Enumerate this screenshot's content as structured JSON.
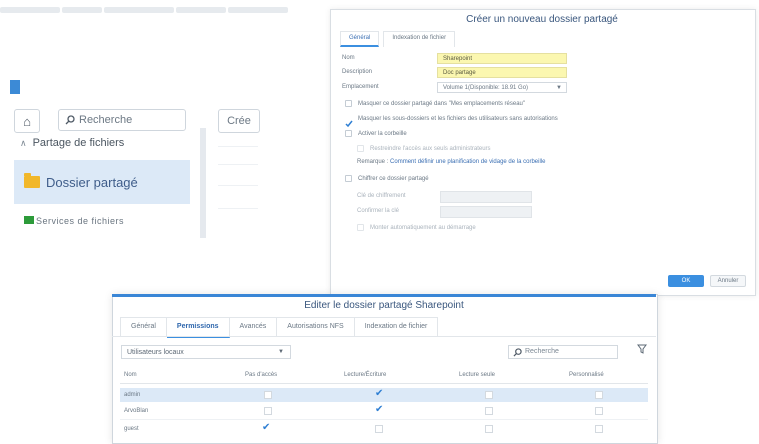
{
  "background": {
    "search_placeholder": "Recherche",
    "create_button": "Crée",
    "section_title": "Partage de fichiers",
    "selected_item": "Dossier partagé",
    "second_item": "Services de fichiers"
  },
  "dialog_create": {
    "title": "Créer un nouveau dossier partagé",
    "tabs": [
      "Général",
      "Indexation de fichier"
    ],
    "fields": [
      {
        "label": "Nom",
        "value": "Sharepoint"
      },
      {
        "label": "Description",
        "value": "Doc partage"
      },
      {
        "label": "Emplacement",
        "value": "Volume 1(Disponible: 18.91 Go)"
      }
    ],
    "checkboxes": [
      {
        "label": "Masquer ce dossier partagé dans \"Mes emplacements réseau\"",
        "checked": false,
        "disabled": false
      },
      {
        "label": "Masquer les sous-dossiers et les fichiers des utilisateurs sans autorisations",
        "checked": true,
        "disabled": false
      },
      {
        "label": "Activer la corbeille",
        "checked": false,
        "disabled": false
      },
      {
        "label": "Restreindre l'accès aux seuls administrateurs",
        "checked": false,
        "disabled": true
      }
    ],
    "remark_prefix": "Remarque :",
    "remark_link": "Comment définir une planification de vidage de la corbeille",
    "encrypt_label": "Chiffrer ce dossier partagé",
    "encrypt_key_label": "Clé de chiffrement",
    "confirm_key_label": "Confirmer la clé",
    "auto_mount_label": "Monter automatiquement au démarrage",
    "ok": "OK",
    "cancel": "Annuler"
  },
  "dialog_edit": {
    "title": "Editer le dossier partagé Sharepoint",
    "tabs": [
      {
        "label": "Général",
        "active": false
      },
      {
        "label": "Permissions",
        "active": true
      },
      {
        "label": "Avancés",
        "active": false
      },
      {
        "label": "Autorisations NFS",
        "active": false
      },
      {
        "label": "Indexation de fichier",
        "active": false
      }
    ],
    "user_filter": "Utilisateurs locaux",
    "search_placeholder": "Recherche",
    "columns": [
      "Nom",
      "Pas d'accès",
      "Lecture/Écriture",
      "Lecture seule",
      "Personnalisé"
    ],
    "rows": [
      {
        "name": "admin",
        "no_access": false,
        "read_write": true,
        "read_only": false,
        "custom": false
      },
      {
        "name": "ArvoBlan",
        "no_access": false,
        "read_write": true,
        "read_only": false,
        "custom": false
      },
      {
        "name": "guest",
        "no_access": true,
        "read_write": false,
        "read_only": false,
        "custom": false
      }
    ]
  }
}
